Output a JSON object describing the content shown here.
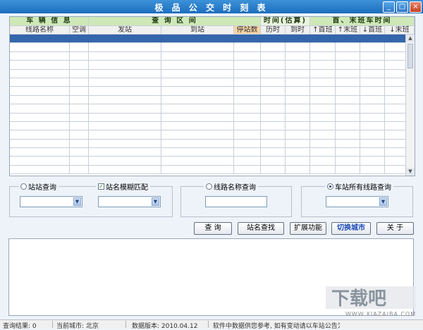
{
  "window": {
    "title": "极 品 公 交 时 刻 表",
    "buttons": {
      "minimize": "_",
      "maximize": "□",
      "close": "×"
    }
  },
  "grid": {
    "groups": [
      "车 辆 信 息",
      "查 询 区 间",
      "时间(估算)",
      "首、末班车时间"
    ],
    "columns": [
      "线路名称",
      "空调",
      "发站",
      "到站",
      "停站数",
      "历时",
      "到时",
      "↑首班",
      "↑末班",
      "↓首班",
      "↓末班"
    ],
    "accent": "#cfe8b8",
    "selection_color": "#3366aa"
  },
  "options": {
    "station_query": "站站查询",
    "fuzzy_match": "站名模糊匹配",
    "line_query": "线路名称查询",
    "all_lines_query": "车站所有线路查询"
  },
  "buttons": {
    "query": "查 询",
    "station_search": "站名查找",
    "extensions": "扩展功能",
    "switch_city": "切换城市",
    "about": "关 于"
  },
  "status": {
    "result": "查询结果: 0",
    "city": "当前城市: 北京",
    "version": "数据版本: 2010.04.12",
    "notice": "软件中数据供您参考, 如有变动请以车站公告为准"
  },
  "watermark": {
    "text": "WWW.XIAZAIBA.COM",
    "logo": "下载吧"
  }
}
